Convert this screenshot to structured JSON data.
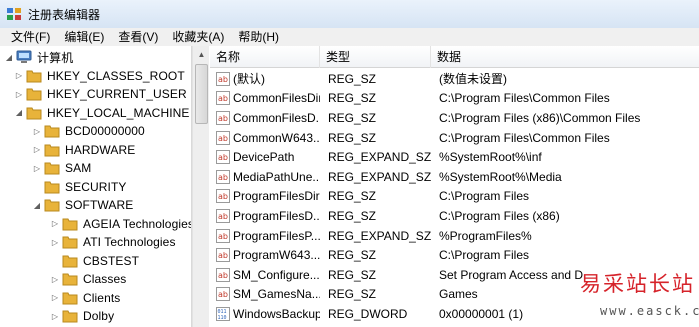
{
  "window": {
    "title": "注册表编辑器"
  },
  "menu": [
    "文件(F)",
    "编辑(E)",
    "查看(V)",
    "收藏夹(A)",
    "帮助(H)"
  ],
  "tree": {
    "root": "计算机",
    "items": [
      {
        "label": "HKEY_CLASSES_ROOT"
      },
      {
        "label": "HKEY_CURRENT_USER"
      },
      {
        "label": "HKEY_LOCAL_MACHINE"
      },
      {
        "label": "BCD00000000"
      },
      {
        "label": "HARDWARE"
      },
      {
        "label": "SAM"
      },
      {
        "label": "SECURITY"
      },
      {
        "label": "SOFTWARE"
      },
      {
        "label": "AGEIA Technologies"
      },
      {
        "label": "ATI Technologies"
      },
      {
        "label": "CBSTEST"
      },
      {
        "label": "Classes"
      },
      {
        "label": "Clients"
      },
      {
        "label": "Dolby"
      }
    ]
  },
  "list": {
    "headers": {
      "name": "名称",
      "type": "类型",
      "data": "数据"
    },
    "rows": [
      {
        "name": "(默认)",
        "type": "REG_SZ",
        "data": "(数值未设置)"
      },
      {
        "name": "CommonFilesDir",
        "type": "REG_SZ",
        "data": "C:\\Program Files\\Common Files"
      },
      {
        "name": "CommonFilesD...",
        "type": "REG_SZ",
        "data": "C:\\Program Files (x86)\\Common Files"
      },
      {
        "name": "CommonW643...",
        "type": "REG_SZ",
        "data": "C:\\Program Files\\Common Files"
      },
      {
        "name": "DevicePath",
        "type": "REG_EXPAND_SZ",
        "data": "%SystemRoot%\\inf"
      },
      {
        "name": "MediaPathUne...",
        "type": "REG_EXPAND_SZ",
        "data": "%SystemRoot%\\Media"
      },
      {
        "name": "ProgramFilesDir",
        "type": "REG_SZ",
        "data": "C:\\Program Files"
      },
      {
        "name": "ProgramFilesD...",
        "type": "REG_SZ",
        "data": "C:\\Program Files (x86)"
      },
      {
        "name": "ProgramFilesP...",
        "type": "REG_EXPAND_SZ",
        "data": "%ProgramFiles%"
      },
      {
        "name": "ProgramW643...",
        "type": "REG_SZ",
        "data": "C:\\Program Files"
      },
      {
        "name": "SM_Configure...",
        "type": "REG_SZ",
        "data": "Set Program Access and D"
      },
      {
        "name": "SM_GamesNa...",
        "type": "REG_SZ",
        "data": "Games"
      },
      {
        "name": "WindowsBackup",
        "type": "REG_DWORD",
        "data": "0x00000001 (1)"
      }
    ]
  },
  "watermark": {
    "text": "易采站长站",
    "url": "www.easck.com"
  },
  "colors": {
    "folder": "#e8b33a",
    "string_icon": "#c0392b",
    "dword_icon": "#2f64b8",
    "watermark": "#d6232a"
  }
}
